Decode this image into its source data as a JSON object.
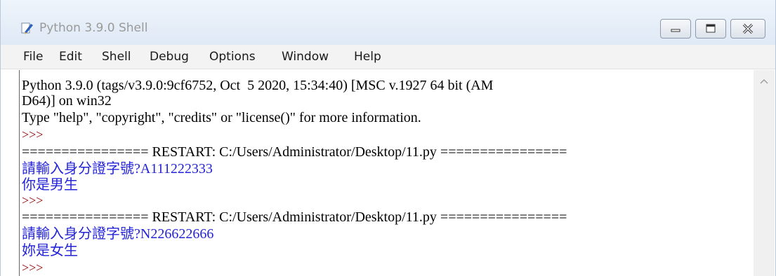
{
  "window": {
    "title": "Python 3.9.0 Shell",
    "icon": "python-feather-icon",
    "controls": [
      "minimize-icon",
      "maximize-icon",
      "close-icon"
    ]
  },
  "menu": [
    "File",
    "Edit",
    "Shell",
    "Debug",
    "Options",
    "Window",
    "Help"
  ],
  "shell": {
    "banner_line1": "Python 3.9.0 (tags/v3.9.0:9cf6752, Oct  5 2020, 15:34:40) [MSC v.1927 64 bit (AM",
    "banner_line2": "D64)] on win32",
    "banner_line3": "Type \"help\", \"copyright\", \"credits\" or \"license()\" for more information.",
    "prompt": ">>>",
    "restart": "================ RESTART: C:/Users/Administrator/Desktop/11.py ================",
    "run1_input": "請輸入身分證字號?A111222333",
    "run1_output": "你是男生",
    "run2_input": "請輸入身分證字號?N226622666",
    "run2_output": "妳是女生"
  },
  "colors": {
    "output_text": "#2424d6",
    "prompt_text": "#8b0000",
    "title_text": "#9a9a9a"
  }
}
